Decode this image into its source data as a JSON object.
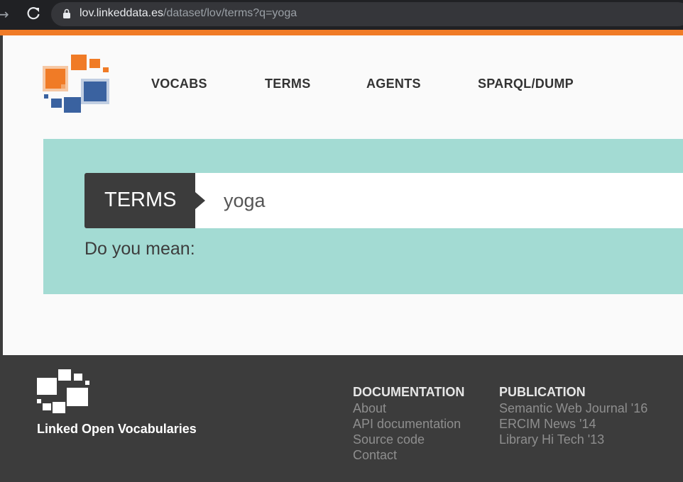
{
  "browser": {
    "back_glyph": "→",
    "url_host": "lov.linkeddata.es",
    "url_path": "/dataset/lov/terms?q=yoga"
  },
  "nav": {
    "items": [
      {
        "label": "VOCABS"
      },
      {
        "label": "TERMS"
      },
      {
        "label": "AGENTS"
      },
      {
        "label": "SPARQL/DUMP"
      }
    ]
  },
  "search": {
    "category_label": "TERMS",
    "query": "yoga",
    "did_you_mean": "Do you mean:"
  },
  "footer": {
    "site_name": "Linked Open Vocabularies",
    "documentation": {
      "title": "DOCUMENTATION",
      "links": [
        "About",
        "API documentation",
        "Source code",
        "Contact"
      ]
    },
    "publication": {
      "title": "PUBLICATION",
      "links": [
        "Semantic Web Journal '16",
        "ERCIM News '14",
        "Library Hi Tech '13"
      ]
    }
  },
  "colors": {
    "accent_orange": "#f07b26",
    "accent_blue": "#3a62a0",
    "hero_teal": "#a3dbd3",
    "dark": "#3c3c3c"
  }
}
